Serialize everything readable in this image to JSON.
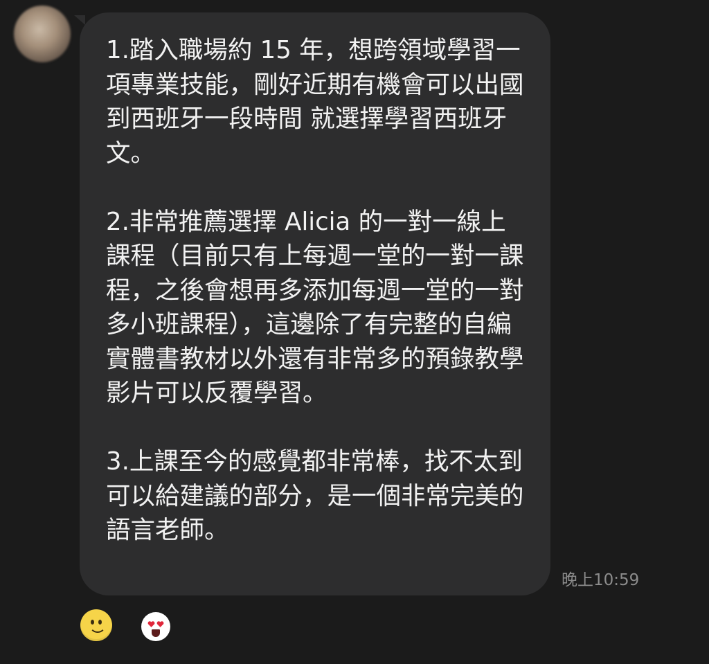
{
  "chat": {
    "message": {
      "paragraphs": [
        "1.踏入職場約 15 年，想跨領域學習一項專業技能，剛好近期有機會可以出國到西班牙一段時間 就選擇學習西班牙文。",
        "2.非常推薦選擇 Alicia 的一對一線上課程（目前只有上每週一堂的一對一課程，之後會想再多添加每週一堂的一對多小班課程），這邊除了有完整的自編實體書教材以外還有非常多的預錄教學影片可以反覆學習。",
        "3.上課至今的感覺都非常棒，找不太到可以給建議的部分，是一個非常完美的語言老師。"
      ],
      "timestamp": "晚上10:59"
    },
    "reactions": [
      "smiling-face-icon",
      "heart-eyes-face-icon"
    ]
  },
  "colors": {
    "background": "#1b1b1b",
    "bubble": "#2d2d2e",
    "text": "#f2f2f2",
    "timestamp": "#8c8c8c",
    "heart": "#e0263a"
  }
}
